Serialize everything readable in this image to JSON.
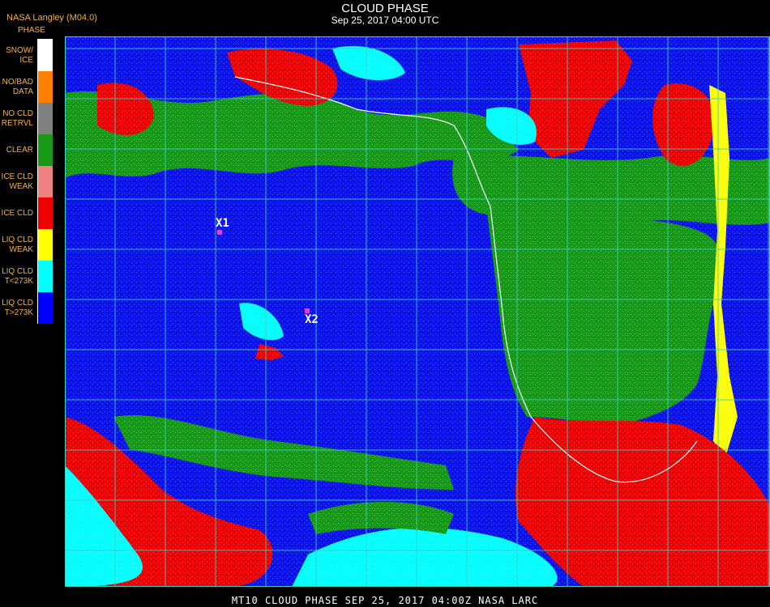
{
  "header": {
    "title": "CLOUD PHASE",
    "subtitle": "Sep 25, 2017 04:00 UTC",
    "organization": "NASA Langley (M04.0)"
  },
  "legend": {
    "title": "PHASE",
    "items": [
      {
        "label": "SNOW/\nICE",
        "color": "#ffffff"
      },
      {
        "label": "NO/BAD\nDATA",
        "color": "#ff7f00"
      },
      {
        "label": "NO CLD\nRETRVL",
        "color": "#808080"
      },
      {
        "label": "CLEAR",
        "color": "#169a16"
      },
      {
        "label": "ICE CLD\nWEAK",
        "color": "#f08080"
      },
      {
        "label": "ICE CLD",
        "color": "#f00000"
      },
      {
        "label": "LIQ CLD\nWEAK",
        "color": "#ffff00"
      },
      {
        "label": "LIQ CLD\nT<273K",
        "color": "#00ffff"
      },
      {
        "label": "LIQ CLD\nT>273K",
        "color": "#0000ff"
      }
    ]
  },
  "map": {
    "colors": {
      "ocean": "#0b12ee",
      "clear": "#169a16",
      "ice": "#f00000",
      "liquid_cold": "#00ffff",
      "liquid_weak": "#ffff00",
      "grid": "#3fd0c0",
      "coast": "#ffffff"
    }
  },
  "markers": [
    {
      "label": "X1"
    },
    {
      "label": "X2"
    }
  ],
  "footer": {
    "text": "MT10  CLOUD PHASE   SEP 25, 2017 04:00Z   NASA LARC"
  }
}
